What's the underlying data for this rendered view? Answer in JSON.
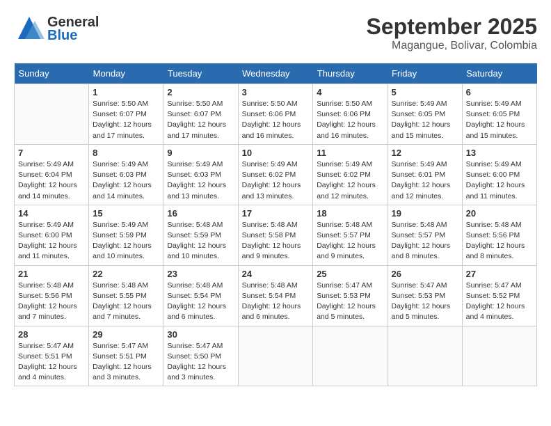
{
  "logo": {
    "general": "General",
    "blue": "Blue"
  },
  "title": "September 2025",
  "location": "Magangue, Bolivar, Colombia",
  "weekdays": [
    "Sunday",
    "Monday",
    "Tuesday",
    "Wednesday",
    "Thursday",
    "Friday",
    "Saturday"
  ],
  "weeks": [
    [
      {
        "day": "",
        "info": ""
      },
      {
        "day": "1",
        "info": "Sunrise: 5:50 AM\nSunset: 6:07 PM\nDaylight: 12 hours\nand 17 minutes."
      },
      {
        "day": "2",
        "info": "Sunrise: 5:50 AM\nSunset: 6:07 PM\nDaylight: 12 hours\nand 17 minutes."
      },
      {
        "day": "3",
        "info": "Sunrise: 5:50 AM\nSunset: 6:06 PM\nDaylight: 12 hours\nand 16 minutes."
      },
      {
        "day": "4",
        "info": "Sunrise: 5:50 AM\nSunset: 6:06 PM\nDaylight: 12 hours\nand 16 minutes."
      },
      {
        "day": "5",
        "info": "Sunrise: 5:49 AM\nSunset: 6:05 PM\nDaylight: 12 hours\nand 15 minutes."
      },
      {
        "day": "6",
        "info": "Sunrise: 5:49 AM\nSunset: 6:05 PM\nDaylight: 12 hours\nand 15 minutes."
      }
    ],
    [
      {
        "day": "7",
        "info": "Sunrise: 5:49 AM\nSunset: 6:04 PM\nDaylight: 12 hours\nand 14 minutes."
      },
      {
        "day": "8",
        "info": "Sunrise: 5:49 AM\nSunset: 6:03 PM\nDaylight: 12 hours\nand 14 minutes."
      },
      {
        "day": "9",
        "info": "Sunrise: 5:49 AM\nSunset: 6:03 PM\nDaylight: 12 hours\nand 13 minutes."
      },
      {
        "day": "10",
        "info": "Sunrise: 5:49 AM\nSunset: 6:02 PM\nDaylight: 12 hours\nand 13 minutes."
      },
      {
        "day": "11",
        "info": "Sunrise: 5:49 AM\nSunset: 6:02 PM\nDaylight: 12 hours\nand 12 minutes."
      },
      {
        "day": "12",
        "info": "Sunrise: 5:49 AM\nSunset: 6:01 PM\nDaylight: 12 hours\nand 12 minutes."
      },
      {
        "day": "13",
        "info": "Sunrise: 5:49 AM\nSunset: 6:00 PM\nDaylight: 12 hours\nand 11 minutes."
      }
    ],
    [
      {
        "day": "14",
        "info": "Sunrise: 5:49 AM\nSunset: 6:00 PM\nDaylight: 12 hours\nand 11 minutes."
      },
      {
        "day": "15",
        "info": "Sunrise: 5:49 AM\nSunset: 5:59 PM\nDaylight: 12 hours\nand 10 minutes."
      },
      {
        "day": "16",
        "info": "Sunrise: 5:48 AM\nSunset: 5:59 PM\nDaylight: 12 hours\nand 10 minutes."
      },
      {
        "day": "17",
        "info": "Sunrise: 5:48 AM\nSunset: 5:58 PM\nDaylight: 12 hours\nand 9 minutes."
      },
      {
        "day": "18",
        "info": "Sunrise: 5:48 AM\nSunset: 5:57 PM\nDaylight: 12 hours\nand 9 minutes."
      },
      {
        "day": "19",
        "info": "Sunrise: 5:48 AM\nSunset: 5:57 PM\nDaylight: 12 hours\nand 8 minutes."
      },
      {
        "day": "20",
        "info": "Sunrise: 5:48 AM\nSunset: 5:56 PM\nDaylight: 12 hours\nand 8 minutes."
      }
    ],
    [
      {
        "day": "21",
        "info": "Sunrise: 5:48 AM\nSunset: 5:56 PM\nDaylight: 12 hours\nand 7 minutes."
      },
      {
        "day": "22",
        "info": "Sunrise: 5:48 AM\nSunset: 5:55 PM\nDaylight: 12 hours\nand 7 minutes."
      },
      {
        "day": "23",
        "info": "Sunrise: 5:48 AM\nSunset: 5:54 PM\nDaylight: 12 hours\nand 6 minutes."
      },
      {
        "day": "24",
        "info": "Sunrise: 5:48 AM\nSunset: 5:54 PM\nDaylight: 12 hours\nand 6 minutes."
      },
      {
        "day": "25",
        "info": "Sunrise: 5:47 AM\nSunset: 5:53 PM\nDaylight: 12 hours\nand 5 minutes."
      },
      {
        "day": "26",
        "info": "Sunrise: 5:47 AM\nSunset: 5:53 PM\nDaylight: 12 hours\nand 5 minutes."
      },
      {
        "day": "27",
        "info": "Sunrise: 5:47 AM\nSunset: 5:52 PM\nDaylight: 12 hours\nand 4 minutes."
      }
    ],
    [
      {
        "day": "28",
        "info": "Sunrise: 5:47 AM\nSunset: 5:51 PM\nDaylight: 12 hours\nand 4 minutes."
      },
      {
        "day": "29",
        "info": "Sunrise: 5:47 AM\nSunset: 5:51 PM\nDaylight: 12 hours\nand 3 minutes."
      },
      {
        "day": "30",
        "info": "Sunrise: 5:47 AM\nSunset: 5:50 PM\nDaylight: 12 hours\nand 3 minutes."
      },
      {
        "day": "",
        "info": ""
      },
      {
        "day": "",
        "info": ""
      },
      {
        "day": "",
        "info": ""
      },
      {
        "day": "",
        "info": ""
      }
    ]
  ]
}
